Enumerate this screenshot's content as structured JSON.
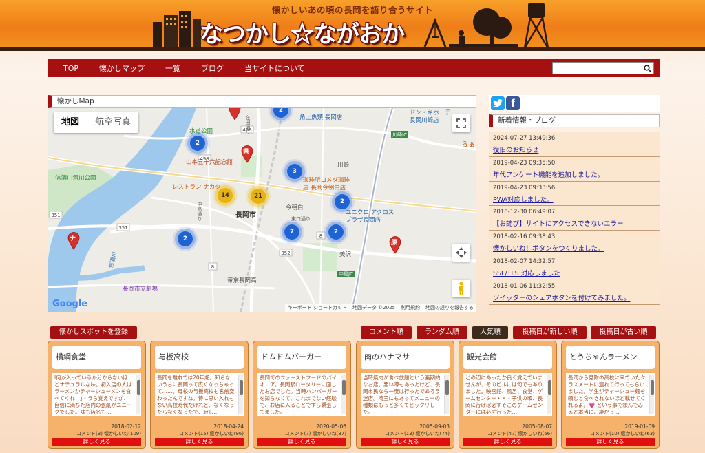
{
  "header": {
    "tagline": "懐かしいあの頃の長岡を語り合うサイト",
    "title": "なつかし☆ながおか"
  },
  "nav": {
    "items": [
      "TOP",
      "懐かしマップ",
      "一覧",
      "ブログ",
      "当サイトについて"
    ],
    "search_value": ""
  },
  "map_panel": {
    "title": "懐かしMap",
    "type_map": "地図",
    "type_satellite": "航空写真",
    "labels": {
      "suido": "水道公園",
      "yamamoto": "山本五十六記念館",
      "shinano": "信濃川河川公園",
      "restaurant": "レストラン ナカタ",
      "komeda1": "珈琲所コメダ珈琲",
      "komeda2": "店 長岡今朝白店",
      "kakujo": "角上魚類 長岡店",
      "donki1": "ドン・キホーテ",
      "donki2": "長岡川崎店",
      "station": "長岡市",
      "kawasaki": "川崎",
      "kesajiro": "今朝白",
      "higashi": "東口通り",
      "unicro1": "ユニクロ アクロス",
      "unicro2": "プラザ長岡店",
      "misawa": "美沢",
      "teikyo": "帝京長岡高",
      "gekijo": "長岡市立劇場",
      "kawasaki_ic": "川崎IC",
      "nagaoka_jc": "中島JC",
      "shinano_river": "信濃川",
      "ra": "らぁ",
      "ken": "県",
      "hara": "原",
      "na": "ナ",
      "nakajima": "中島通り",
      "zaioh": "在田通り"
    },
    "clusters": [
      "2",
      "2",
      "3",
      "14",
      "21",
      "2",
      "2",
      "7",
      "2"
    ],
    "footer": {
      "keyboard": "キーボード ショートカット",
      "mapdata": "地図データ ©2025",
      "terms": "利用規約",
      "report": "地図の誤りを報告する"
    },
    "google": "Google",
    "roads": [
      "498",
      "498",
      "352",
      "351",
      "351",
      "8",
      "8"
    ]
  },
  "news": {
    "title": "新着情報・ブログ",
    "items": [
      {
        "date": "2024-07-27 13:49:36",
        "text": "復旧のお知らせ"
      },
      {
        "date": "2019-04-23 09:35:50",
        "text": "年代アンケート機能を追加しました。"
      },
      {
        "date": "2019-04-23 09:33:56",
        "text": "PWA対応しました。"
      },
      {
        "date": "2018-12-30 06:49:07",
        "text": "【お詫び】サイトにアクセスできないエラー"
      },
      {
        "date": "2018-02-16 09:38:43",
        "text": "懐かしいね！ボタンをつくりました。"
      },
      {
        "date": "2018-02-07 14:32:57",
        "text": "SSL/TLS 対応しました"
      },
      {
        "date": "2018-01-06 11:32:55",
        "text": "ツイッターのシェアボタンを付けてみました。"
      }
    ]
  },
  "actions": {
    "register": "懐かしスポットを登録",
    "sort_comment": "コメント順",
    "sort_random": "ランダム順",
    "sort_popular": "人気順",
    "sort_new": "投稿日が新しい順",
    "sort_old": "投稿日が古い順"
  },
  "cards": [
    {
      "title": "横綱食堂",
      "desc": "l何が入っているか分からないほどナチュラルな味。初入店の人はラーメンかチャーシューメンを食べてくれ！」・うら覚えですが、自信に満ちた店内の張紙がユニークでした。味も店名も…",
      "date": "2018-02-12",
      "meta": "コメント(3) 懐かしいね(109)",
      "more": "詳しく見る"
    },
    {
      "title": "与板高校",
      "desc": "長岡を離れては20年超。知らないうちに長岡って広くなっちゃって……。母校の与板高校も名前変わったんですね。特に思い入れもない高校時代だけれど、なくなったらなくなったで、寂し…",
      "date": "2018-04-24",
      "meta": "コメント(15) 懐かしいね(96)",
      "more": "詳しく見る"
    },
    {
      "title": "ドムドムバーガー",
      "desc": "長岡でのファーストフードのパイオニア。長岡駅ロータリーに面したお店でした。当時ハンバーガーを知らなくて、これまでない経験で、お店に入ることですら緊張してました。",
      "date": "2020-05-06",
      "meta": "コメント(7) 懐かしいね(87)",
      "more": "詳しく見る"
    },
    {
      "title": "肉のハナマサ",
      "desc": "当時焼肉が食べ放題という画期的なお店。悪い噂もあったけど、長岡市民なら一度は行ったであろう迷店。埼玉にもあってメニューの種類はもっと多くてビックリした。",
      "date": "2005-09-03",
      "meta": "コメント(13) 懐かしいね(74)",
      "more": "詳しく見る"
    },
    {
      "title": "観光会館",
      "desc": "どの辺にあったか良く覚えていませんが、そのビルには何でもありました。映画館、風呂、食堂、ゲームセンター・・・子供の頃、長岡に行けば必ずそこのゲームセンターには必ず行った…",
      "date": "2005-08-07",
      "meta": "コメント(47) 懐かしいね(66)",
      "more": "詳しく見る"
    },
    {
      "title": "とうちゃんラーメン",
      "desc": "長岡から見附の高校に来ていたクラスメートに連れて行ってもらいました。学生がチャーシュー麺を頼むと食べきれないほど載せてくれるよ。💗 という事で頼んでみると本当に、凄かっ…",
      "date": "2019-01-09",
      "meta": "コメント(10) 懐かしいね(63)",
      "more": "詳しく見る"
    }
  ]
}
